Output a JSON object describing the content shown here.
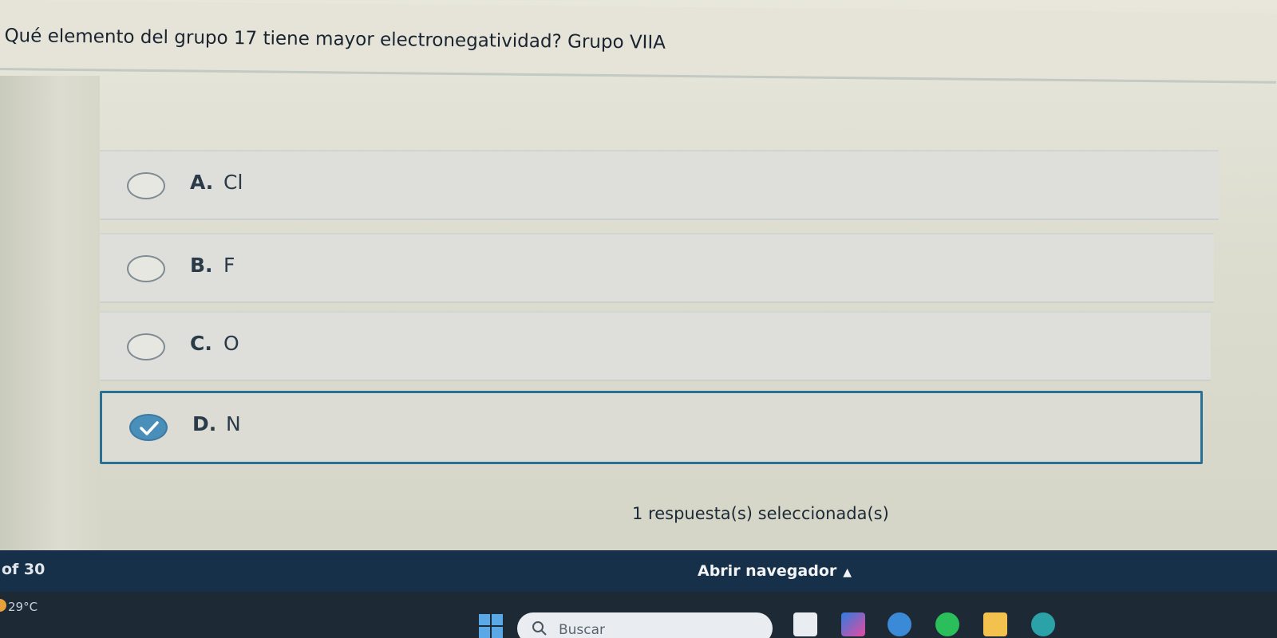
{
  "question": {
    "text": "Qué elemento del  grupo 17 tiene mayor  electronegatividad?  Grupo VIIA"
  },
  "options": [
    {
      "letter": "A.",
      "text": "Cl",
      "selected": false
    },
    {
      "letter": "B.",
      "text": "F",
      "selected": false
    },
    {
      "letter": "C.",
      "text": "O",
      "selected": false
    },
    {
      "letter": "D.",
      "text": "N",
      "selected": true
    }
  ],
  "status": {
    "selection_count": "1 respuesta(s) seleccionada(s)"
  },
  "footer": {
    "page_count": "of 30",
    "open_navigator": "Abrir navegador",
    "open_navigator_arrow": "▲"
  },
  "taskbar": {
    "temperature": "29°C",
    "search_placeholder": "Buscar"
  },
  "colors": {
    "accent": "#2c6f95",
    "checked_radio": "#4a8fba",
    "footer_bar": "#163049",
    "taskbar": "#1d2a36"
  },
  "icons": {
    "check": "check-icon",
    "search": "search-icon",
    "start": "windows-start-icon",
    "weather": "weather-icon",
    "navigator_arrow": "triangle-up-icon"
  }
}
